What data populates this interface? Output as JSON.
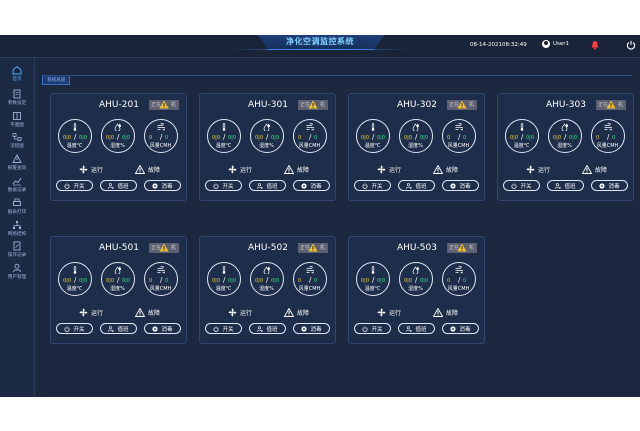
{
  "header": {
    "title": "净化空调监控系统",
    "date": "08-14-2021",
    "time": "08:32:49",
    "user": "User1"
  },
  "sidebar": {
    "items": [
      {
        "label": "首页",
        "icon": "home-icon"
      },
      {
        "label": "参数设定",
        "icon": "settings-doc-icon"
      },
      {
        "label": "平面图",
        "icon": "floorplan-icon"
      },
      {
        "label": "流程图",
        "icon": "flow-icon"
      },
      {
        "label": "报警查询",
        "icon": "alarm-icon"
      },
      {
        "label": "数据记录",
        "icon": "chart-icon"
      },
      {
        "label": "报表打印",
        "icon": "print-icon"
      },
      {
        "label": "网络结构",
        "icon": "network-icon"
      },
      {
        "label": "操作记录",
        "icon": "log-icon"
      },
      {
        "label": "用户管理",
        "icon": "user-icon"
      }
    ]
  },
  "tab": "系统总览",
  "card_common": {
    "mode": "正在",
    "mode_suffix": "机",
    "temp_label": "温度℃",
    "hum_label": "湿度%",
    "air_label": "风量CMH",
    "run": "运行",
    "fault": "故障",
    "power_btn": "开关",
    "duty_btn": "值班",
    "disinfect_btn": "消毒",
    "val_a": "0|0",
    "val_b": "0",
    "slash": "/"
  },
  "units": [
    "AHU-201",
    "AHU-301",
    "AHU-302",
    "AHU-303",
    "AHU-501",
    "AHU-502",
    "AHU-503"
  ],
  "colors": {
    "background": "#1c2840",
    "card": "#1e2d4a",
    "accent": "#3b8cff",
    "alarm": "#ff3b3b",
    "value_yellow": "#e8d23a",
    "value_green": "#2ee08a"
  }
}
